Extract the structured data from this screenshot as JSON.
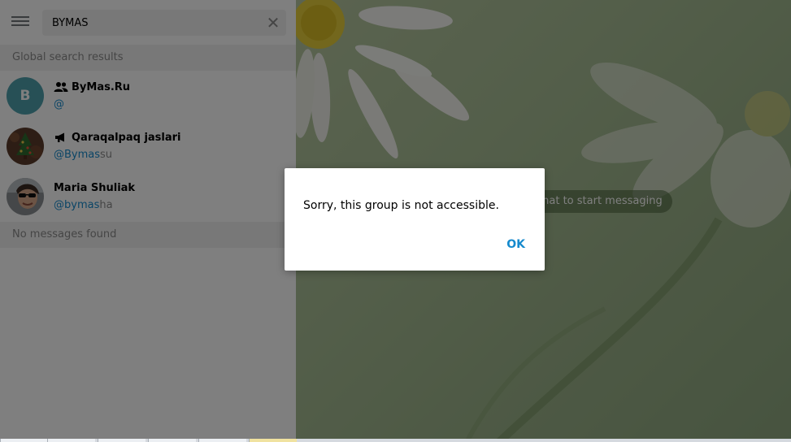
{
  "search": {
    "value": "BYMAS"
  },
  "sections": {
    "global_results": "Global search results",
    "no_messages": "No messages found"
  },
  "results": [
    {
      "name": "ByMas.Ru",
      "avatar_letter": "B",
      "kind_icon": "group-icon",
      "handle_match": "@",
      "handle_rest": ""
    },
    {
      "name": "Qaraqalpaq jaslari",
      "kind_icon": "megaphone-icon",
      "handle_match": "@Bymas",
      "handle_rest": "su"
    },
    {
      "name": "Maria Shuliak",
      "handle_match": "@bymas",
      "handle_rest": "ha"
    }
  ],
  "chat": {
    "empty_hint": "chat to start messaging"
  },
  "dialog": {
    "message": "Sorry, this group is not accessible.",
    "ok_label": "OK"
  },
  "colors": {
    "accent": "#168acd",
    "avatar_b": "#4fa1ad",
    "section_bg": "#f1f1f1"
  }
}
